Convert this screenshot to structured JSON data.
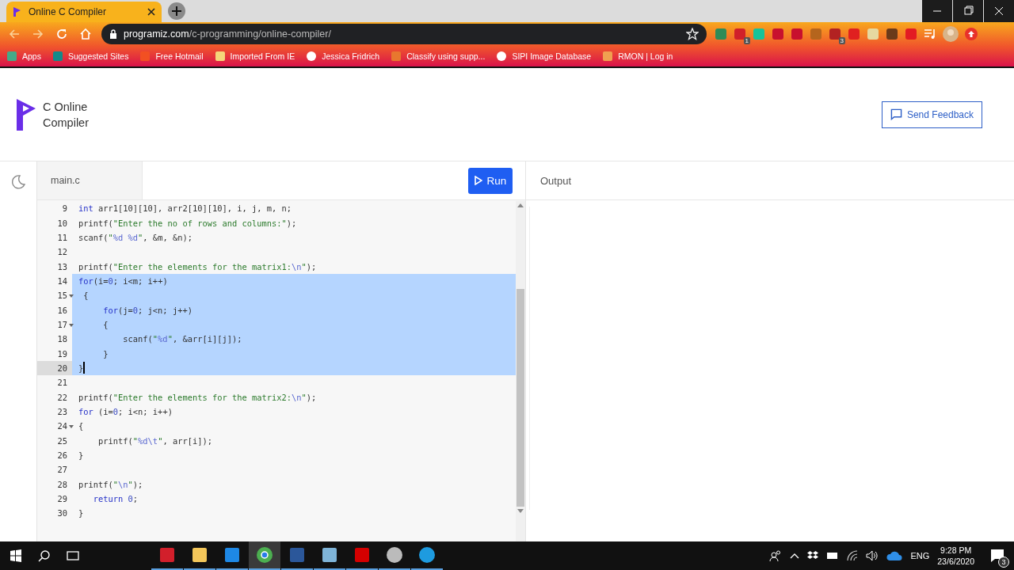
{
  "browser": {
    "tab_title": "Online C Compiler",
    "url_host": "programiz.com",
    "url_path": "/c-programming/online-compiler/",
    "bookmarks": [
      {
        "label": "Apps",
        "kind": "grid"
      },
      {
        "label": "Suggested Sites",
        "kind": "bing"
      },
      {
        "label": "Free Hotmail",
        "kind": "windows"
      },
      {
        "label": "Imported From IE",
        "kind": "folder"
      },
      {
        "label": "Jessica Fridrich",
        "kind": "globe"
      },
      {
        "label": "Classify using supp...",
        "kind": "matlab"
      },
      {
        "label": "SIPI Image Database",
        "kind": "globe"
      },
      {
        "label": "RMON | Log in",
        "kind": "rmon"
      }
    ],
    "extensions": [
      {
        "color": "#2e8b57"
      },
      {
        "color": "#d0202a",
        "badge": "1"
      },
      {
        "color": "#15c39a"
      },
      {
        "color": "#c8102e"
      },
      {
        "color": "#c8102e"
      },
      {
        "color": "#b5651d"
      },
      {
        "color": "#b22222",
        "badge": "3"
      },
      {
        "color": "#e02020"
      },
      {
        "color": "#e6d9a0"
      },
      {
        "color": "#6b3a1a"
      },
      {
        "color": "#e31b23"
      }
    ]
  },
  "header": {
    "logo_line1": "C Online",
    "logo_line2": "Compiler",
    "feedback_button": "Send Feedback"
  },
  "editor": {
    "file_tab": "main.c",
    "run_button": "Run",
    "output_title": "Output",
    "lines": [
      {
        "n": "9",
        "tokens": [
          {
            "kind": "kw",
            "t": "int"
          },
          {
            "kind": "plain",
            "t": " arr1[10][10], arr2[10][10], i, j, m, n;"
          }
        ]
      },
      {
        "n": "10",
        "tokens": [
          {
            "kind": "plain",
            "t": "printf("
          },
          {
            "kind": "str",
            "t": "\"Enter the no of rows and columns:\""
          },
          {
            "kind": "plain",
            "t": ");"
          }
        ]
      },
      {
        "n": "11",
        "tokens": [
          {
            "kind": "plain",
            "t": "scanf("
          },
          {
            "kind": "str",
            "t": "\""
          },
          {
            "kind": "esc",
            "t": "%d %d"
          },
          {
            "kind": "str",
            "t": "\""
          },
          {
            "kind": "plain",
            "t": ", &m, &n);"
          }
        ]
      },
      {
        "n": "12"
      },
      {
        "n": "13",
        "tokens": [
          {
            "kind": "plain",
            "t": "printf("
          },
          {
            "kind": "str",
            "t": "\"Enter the elements for the matrix1:"
          },
          {
            "kind": "esc",
            "t": "\\n"
          },
          {
            "kind": "str",
            "t": "\""
          },
          {
            "kind": "plain",
            "t": ");"
          }
        ]
      },
      {
        "n": "14",
        "selected": true,
        "tokens": [
          {
            "kind": "kw",
            "t": "for"
          },
          {
            "kind": "plain",
            "t": "(i="
          },
          {
            "kind": "num",
            "t": "0"
          },
          {
            "kind": "plain",
            "t": "; i<m; i++)"
          }
        ]
      },
      {
        "n": "15",
        "selected": true,
        "fold": true,
        "tokens": [
          {
            "kind": "plain",
            "t": " {"
          }
        ]
      },
      {
        "n": "16",
        "selected": true,
        "tokens": [
          {
            "kind": "kw",
            "t": "     for"
          },
          {
            "kind": "plain",
            "t": "(j="
          },
          {
            "kind": "num",
            "t": "0"
          },
          {
            "kind": "plain",
            "t": "; j<n; j++)"
          }
        ]
      },
      {
        "n": "17",
        "selected": true,
        "fold": true,
        "tokens": [
          {
            "kind": "plain",
            "t": "     {"
          }
        ]
      },
      {
        "n": "18",
        "selected": true,
        "tokens": [
          {
            "kind": "plain",
            "t": "         scanf("
          },
          {
            "kind": "str",
            "t": "\""
          },
          {
            "kind": "esc",
            "t": "%d"
          },
          {
            "kind": "str",
            "t": "\""
          },
          {
            "kind": "plain",
            "t": ", &arr[i][j]);"
          }
        ]
      },
      {
        "n": "19",
        "selected": true,
        "tokens": [
          {
            "kind": "plain",
            "t": "     }"
          }
        ]
      },
      {
        "n": "20",
        "selected": true,
        "active": true,
        "tokens": [
          {
            "kind": "plain",
            "t": "}"
          }
        ]
      },
      {
        "n": "21"
      },
      {
        "n": "22",
        "tokens": [
          {
            "kind": "plain",
            "t": "printf("
          },
          {
            "kind": "str",
            "t": "\"Enter the elements for the matrix2:"
          },
          {
            "kind": "esc",
            "t": "\\n"
          },
          {
            "kind": "str",
            "t": "\""
          },
          {
            "kind": "plain",
            "t": ");"
          }
        ]
      },
      {
        "n": "23",
        "tokens": [
          {
            "kind": "kw",
            "t": "for"
          },
          {
            "kind": "plain",
            "t": " (i="
          },
          {
            "kind": "num",
            "t": "0"
          },
          {
            "kind": "plain",
            "t": "; i<n; i++)"
          }
        ]
      },
      {
        "n": "24",
        "fold": true,
        "tokens": [
          {
            "kind": "plain",
            "t": "{"
          }
        ]
      },
      {
        "n": "25",
        "tokens": [
          {
            "kind": "plain",
            "t": "    printf("
          },
          {
            "kind": "str",
            "t": "\""
          },
          {
            "kind": "esc",
            "t": "%d\\t"
          },
          {
            "kind": "str",
            "t": "\""
          },
          {
            "kind": "plain",
            "t": ", arr[i]);"
          }
        ]
      },
      {
        "n": "26",
        "tokens": [
          {
            "kind": "plain",
            "t": "}"
          }
        ]
      },
      {
        "n": "27"
      },
      {
        "n": "28",
        "tokens": [
          {
            "kind": "plain",
            "t": "printf("
          },
          {
            "kind": "str",
            "t": "\""
          },
          {
            "kind": "esc",
            "t": "\\n"
          },
          {
            "kind": "str",
            "t": "\""
          },
          {
            "kind": "plain",
            "t": ");"
          }
        ]
      },
      {
        "n": "29",
        "tokens": [
          {
            "kind": "kw",
            "t": "   return "
          },
          {
            "kind": "num",
            "t": "0"
          },
          {
            "kind": "plain",
            "t": ";"
          }
        ]
      },
      {
        "n": "30",
        "tokens": [
          {
            "kind": "plain",
            "t": "}"
          }
        ]
      }
    ]
  },
  "taskbar": {
    "apps": [
      {
        "kind": "gift",
        "selected": false
      },
      {
        "kind": "folder",
        "selected": false
      },
      {
        "kind": "mail",
        "selected": false
      },
      {
        "kind": "chrome",
        "selected": true
      },
      {
        "kind": "word",
        "selected": false
      },
      {
        "kind": "notepad",
        "selected": false
      },
      {
        "kind": "pdf",
        "selected": false
      },
      {
        "kind": "speaker",
        "selected": false
      },
      {
        "kind": "record",
        "selected": false
      }
    ],
    "language": "ENG",
    "time": "9:28 PM",
    "date": "23/6/2020",
    "notification_count": "3"
  }
}
